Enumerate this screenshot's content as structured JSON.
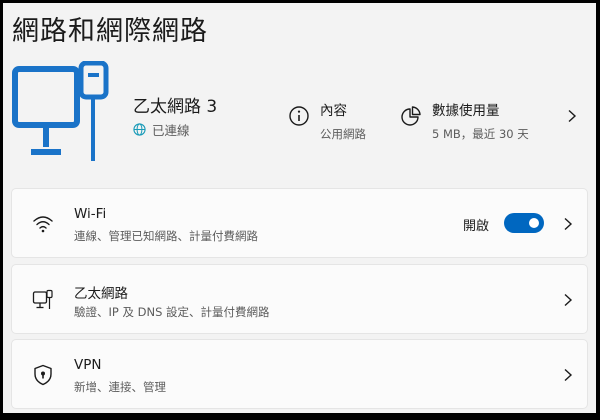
{
  "page": {
    "title": "網路和網際網路"
  },
  "connection": {
    "name": "乙太網路 3",
    "status": "已連線",
    "icon": "ethernet-monitor-icon",
    "status_icon": "globe-icon"
  },
  "properties": [
    {
      "icon": "info-icon",
      "title": "內容",
      "subtitle": "公用網路"
    },
    {
      "icon": "pie-chart-icon",
      "title": "數據使用量",
      "subtitle": "5 MB，最近 30 天"
    }
  ],
  "cards": [
    {
      "id": "wifi",
      "icon": "wifi-icon",
      "title": "Wi-Fi",
      "subtitle": "連線、管理已知網路、計量付費網路",
      "toggle_label": "開啟",
      "toggle_on": true
    },
    {
      "id": "ethernet",
      "icon": "ethernet-icon",
      "title": "乙太網路",
      "subtitle": "驗證、IP 及 DNS 設定、計量付費網路"
    },
    {
      "id": "vpn",
      "icon": "shield-lock-icon",
      "title": "VPN",
      "subtitle": "新增、連接、管理"
    }
  ],
  "colors": {
    "accent": "#0067c0",
    "hero_icon": "#1a73c8",
    "background": "#f3f3f3",
    "card": "#fbfbfb"
  }
}
